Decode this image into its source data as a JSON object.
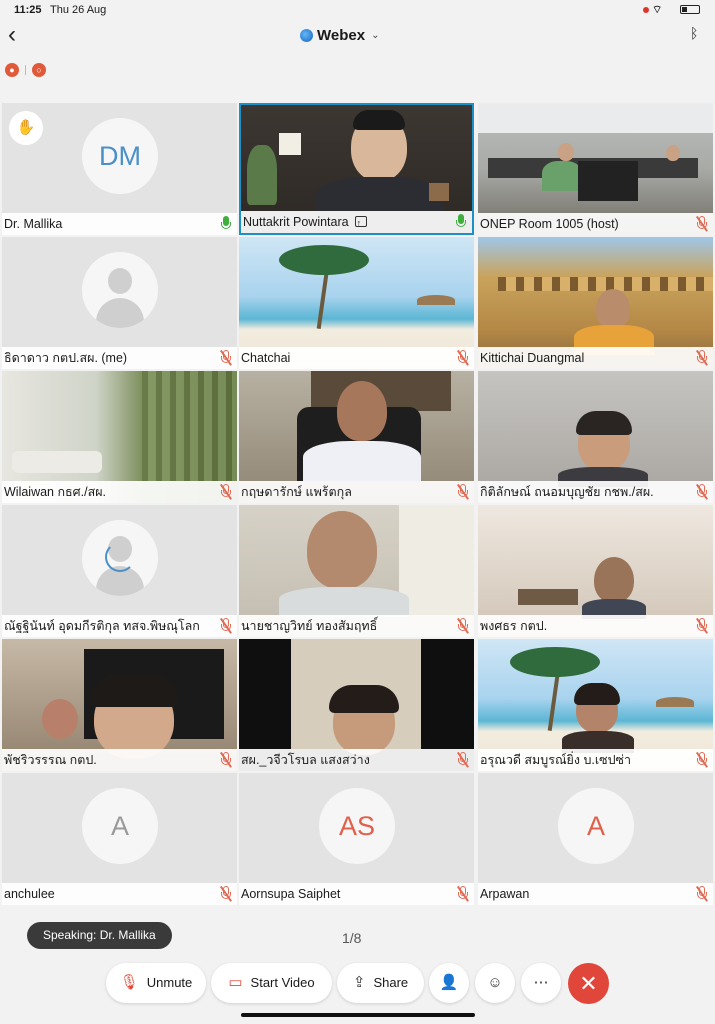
{
  "status_bar": {
    "time": "11:25",
    "date": "Thu 26 Aug"
  },
  "header": {
    "title": "Webex"
  },
  "participants": [
    {
      "name": "Dr. Mallika",
      "initials": "DM",
      "mic": "on",
      "type": "avatar",
      "avatar_color": "blue",
      "raise_hand": true
    },
    {
      "name": "Nuttakrit Powintara",
      "mic": "on",
      "type": "video",
      "sharing": true,
      "active": true
    },
    {
      "name": "ONEP Room 1005 (host)",
      "mic": "muted",
      "type": "video"
    },
    {
      "name": "ธิดาดาว กตป.สผ. (me)",
      "mic": "muted",
      "type": "placeholder"
    },
    {
      "name": "Chatchai",
      "mic": "muted",
      "type": "video"
    },
    {
      "name": "Kittichai Duangmal",
      "mic": "muted",
      "type": "video"
    },
    {
      "name": "Wilaiwan กธศ./สผ.",
      "mic": "muted",
      "type": "video"
    },
    {
      "name": "กฤษดารักษ์ แพร้ตกุล",
      "mic": "muted",
      "type": "video"
    },
    {
      "name": "กิติลักษณ์ ถนอมบุญชัย กชพ./สผ.",
      "mic": "muted",
      "type": "video"
    },
    {
      "name": "ณัฐฐินันท์ อุดมกีรติกุล ทสจ.พิษณุโลก",
      "mic": "muted",
      "type": "loading"
    },
    {
      "name": "นายชาญวิทย์ ทองสัมฤทธิ์",
      "mic": "muted",
      "type": "video"
    },
    {
      "name": "พงศธร กตป.",
      "mic": "muted",
      "type": "video"
    },
    {
      "name": "พัชริวรรรณ กตป.",
      "mic": "muted",
      "type": "video"
    },
    {
      "name": "สผ._วจีวโรบล แสงสว่าง",
      "mic": "muted",
      "type": "video"
    },
    {
      "name": "อรุณวดี สมบูรณ์ยิ่ง บ.เซปซ่า",
      "mic": "muted",
      "type": "video"
    },
    {
      "name": "anchulee",
      "initials": "A",
      "mic": "muted",
      "type": "avatar",
      "avatar_color": "grey"
    },
    {
      "name": "Aornsupa Saiphet",
      "initials": "AS",
      "mic": "muted",
      "type": "avatar",
      "avatar_color": "red"
    },
    {
      "name": "Arpawan",
      "initials": "A",
      "mic": "muted",
      "type": "avatar",
      "avatar_color": "red"
    }
  ],
  "speaking": "Speaking: Dr. Mallika",
  "page_indicator": "1/8",
  "controls": {
    "unmute_label": "Unmute",
    "start_video_label": "Start Video",
    "share_label": "Share"
  },
  "colors": {
    "accent": "#1e90c8",
    "muted": "#e06a54",
    "end_call": "#e0463a",
    "mic_on": "#3fae3f"
  },
  "icons": [
    "back-icon",
    "webex-logo-icon",
    "bluetooth-icon",
    "raise-hand-icon",
    "mic-muted-icon",
    "video-off-icon",
    "share-icon",
    "participants-icon",
    "reactions-icon",
    "more-icon",
    "end-call-icon"
  ]
}
